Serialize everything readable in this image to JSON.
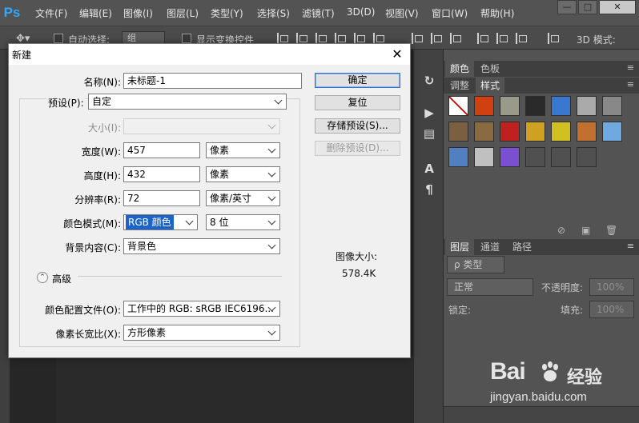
{
  "app": {
    "logo": "Ps",
    "menu": [
      "文件(F)",
      "编辑(E)",
      "图像(I)",
      "图层(L)",
      "类型(Y)",
      "选择(S)",
      "滤镜(T)",
      "3D(D)",
      "视图(V)",
      "窗口(W)",
      "帮助(H)"
    ],
    "window_controls": {
      "minimize": "—",
      "restore": "□",
      "close": "✕"
    }
  },
  "options_bar": {
    "auto_select_label": "自动选择:",
    "auto_select_value": "组",
    "show_transform_label": "显示变换控件",
    "mode_3d_label": "3D 模式:"
  },
  "right_panel": {
    "top_tabs": [
      "颜色",
      "色板"
    ],
    "second_tabs": [
      "调整",
      "样式"
    ],
    "layers_tabs": [
      "图层",
      "通道",
      "路径"
    ],
    "kind_filter": "ρ 类型",
    "blend_mode": "正常",
    "opacity_label": "不透明度:",
    "opacity_value": "100%",
    "lock_label": "锁定:",
    "fill_label": "填充:",
    "fill_value": "100%",
    "style_colors": [
      "#ffffff",
      "#d04010",
      "#9a9a8a",
      "#2a2a2a",
      "#3a78d0",
      "#aaaaaa",
      "#888888",
      "#7a6040",
      "#8a6a40",
      "#c02020",
      "#d0a020",
      "#d0c020",
      "#c07030",
      "#70a8e0",
      "#5080c0",
      "#c0c0c0",
      "#7a50d0",
      "#505050",
      "#505050",
      "#505050"
    ]
  },
  "watermark": {
    "brand": "Bai",
    "brand_cn": "经验",
    "url": "jingyan.baidu.com"
  },
  "dialog": {
    "title": "新建",
    "close": "✕",
    "name_label": "名称(N):",
    "name_value": "未标题-1",
    "preset_label": "预设(P):",
    "preset_value": "自定",
    "size_label": "大小(I):",
    "size_value": "",
    "width_label": "宽度(W):",
    "width_value": "457",
    "width_unit": "像素",
    "height_label": "高度(H):",
    "height_value": "432",
    "height_unit": "像素",
    "resolution_label": "分辨率(R):",
    "resolution_value": "72",
    "resolution_unit": "像素/英寸",
    "color_mode_label": "颜色模式(M):",
    "color_mode_value": "RGB 颜色",
    "bit_depth_value": "8 位",
    "background_label": "背景内容(C):",
    "background_value": "背景色",
    "advanced_label": "高级",
    "advanced_icon": "⌃",
    "color_profile_label": "颜色配置文件(O):",
    "color_profile_value": "工作中的 RGB: sRGB IEC6196...",
    "pixel_aspect_label": "像素长宽比(X):",
    "pixel_aspect_value": "方形像素",
    "ok_button": "确定",
    "reset_button": "复位",
    "save_preset_button": "存储预设(S)...",
    "delete_preset_button": "删除预设(D)...",
    "image_size_label": "图像大小:",
    "image_size_value": "578.4K"
  }
}
